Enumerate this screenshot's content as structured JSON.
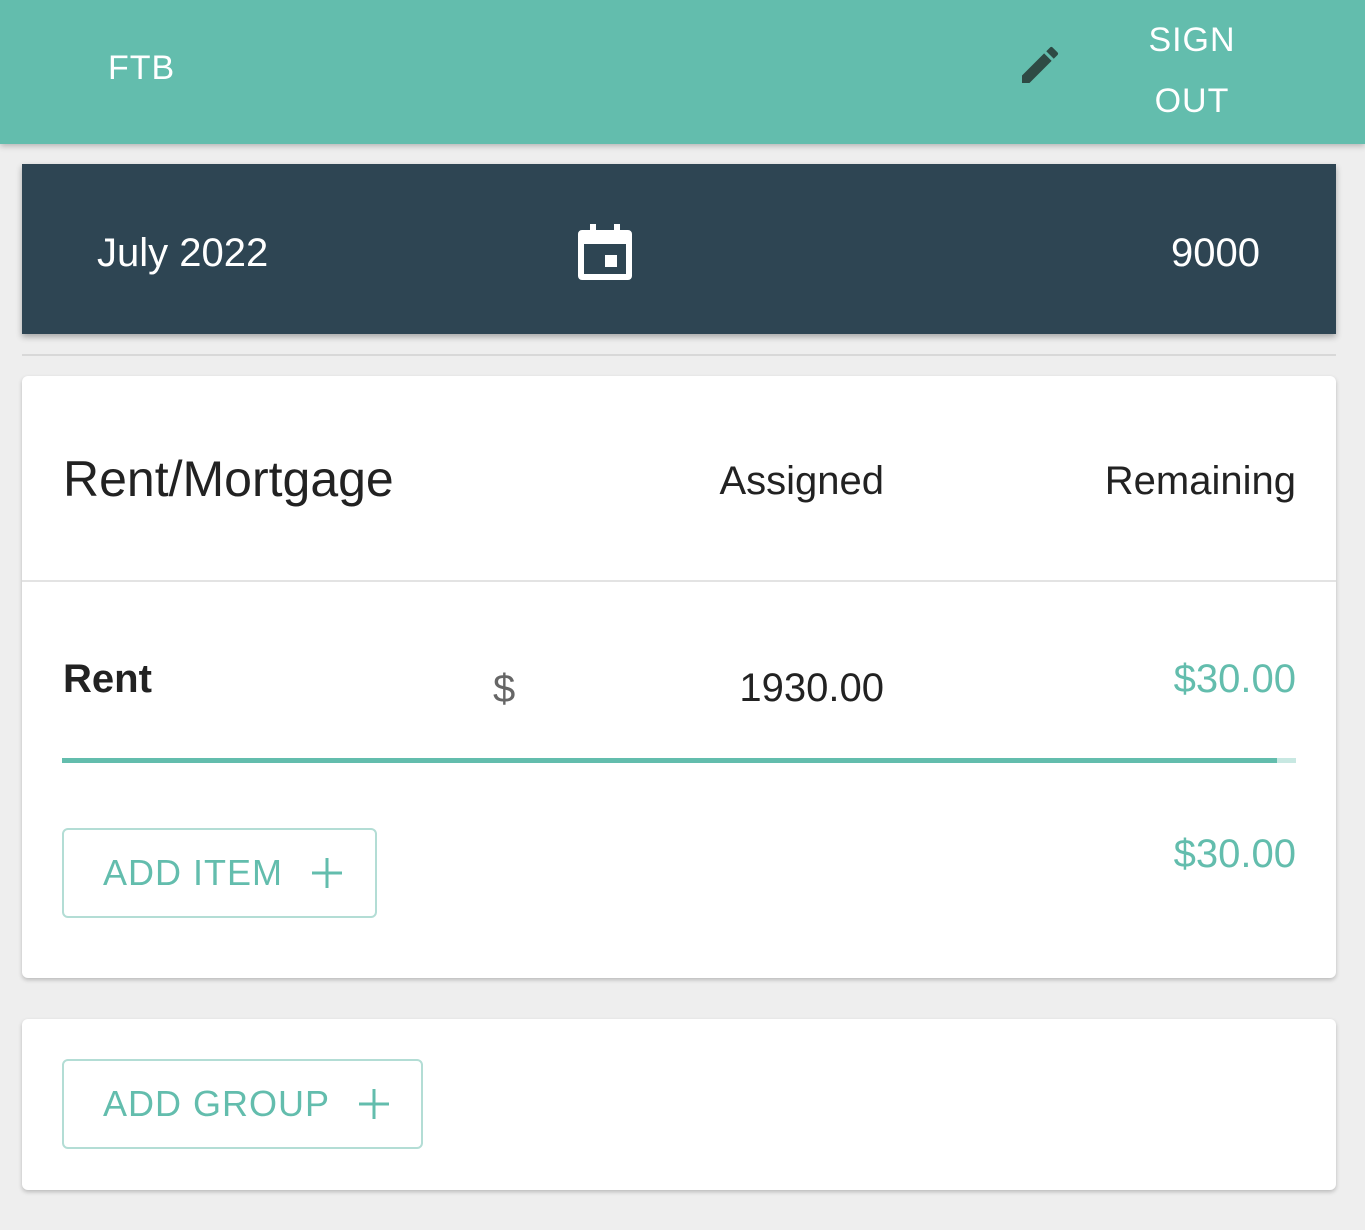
{
  "appbar": {
    "title": "FTB",
    "edit_icon": "pencil-icon",
    "signout_label": "SIGN OUT",
    "color": "#63bdad"
  },
  "month_bar": {
    "month": "July 2022",
    "calendar_icon": "calendar-icon",
    "total": "9000",
    "color": "#2e4553"
  },
  "group": {
    "name": "Rent/Mortgage",
    "col_assigned": "Assigned",
    "col_remaining": "Remaining",
    "items": [
      {
        "name": "Rent",
        "currency": "$",
        "assigned": "1930.00",
        "remaining": "$30.00",
        "progress_fraction": 0.985
      }
    ],
    "add_item_label": "ADD ITEM",
    "group_remaining": "$30.00"
  },
  "add_group": {
    "label": "ADD GROUP"
  },
  "colors": {
    "accent": "#63bdad",
    "background": "#eeeeee"
  }
}
